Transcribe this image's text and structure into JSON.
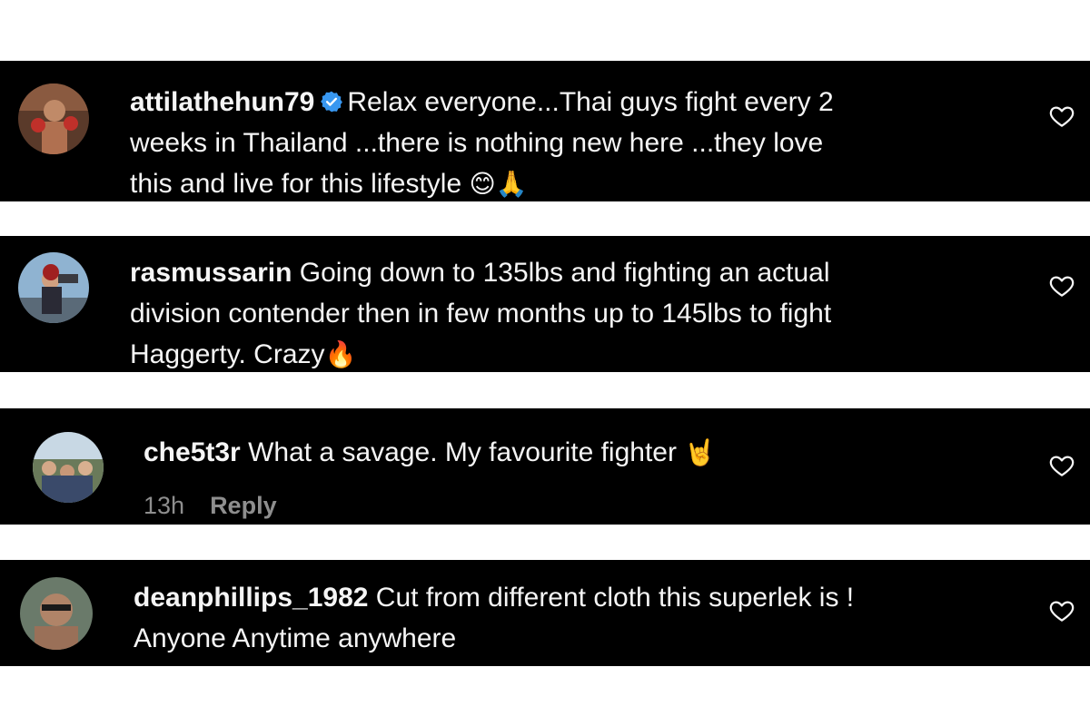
{
  "comments": [
    {
      "username": "attilathehun79",
      "verified": true,
      "lines": [
        "Relax everyone...Thai guys fight every 2",
        "weeks in Thailand ...there is nothing new here ...they love",
        "this and live for this lifestyle"
      ],
      "emoji": "😊🙏"
    },
    {
      "username": "rasmussarin",
      "verified": false,
      "lines": [
        "Going down to 135lbs and fighting an actual",
        "division contender then in few months up to 145lbs to fight",
        "Haggerty. Crazy"
      ],
      "emoji": "🔥"
    },
    {
      "username": "che5t3r",
      "verified": false,
      "lines": [
        "What a savage. My favourite fighter"
      ],
      "emoji": "🤘",
      "time": "13h",
      "reply_label": "Reply"
    },
    {
      "username": "deanphillips_1982",
      "verified": false,
      "lines": [
        "Cut from different cloth this superlek is !",
        "Anyone Anytime anywhere"
      ]
    }
  ],
  "icons": {
    "like": "heart-outline-icon",
    "verified": "verified-badge-icon"
  },
  "colors": {
    "background": "#000000",
    "text": "#f5f5f5",
    "meta": "#8e8e8e",
    "verified": "#3897f0"
  }
}
